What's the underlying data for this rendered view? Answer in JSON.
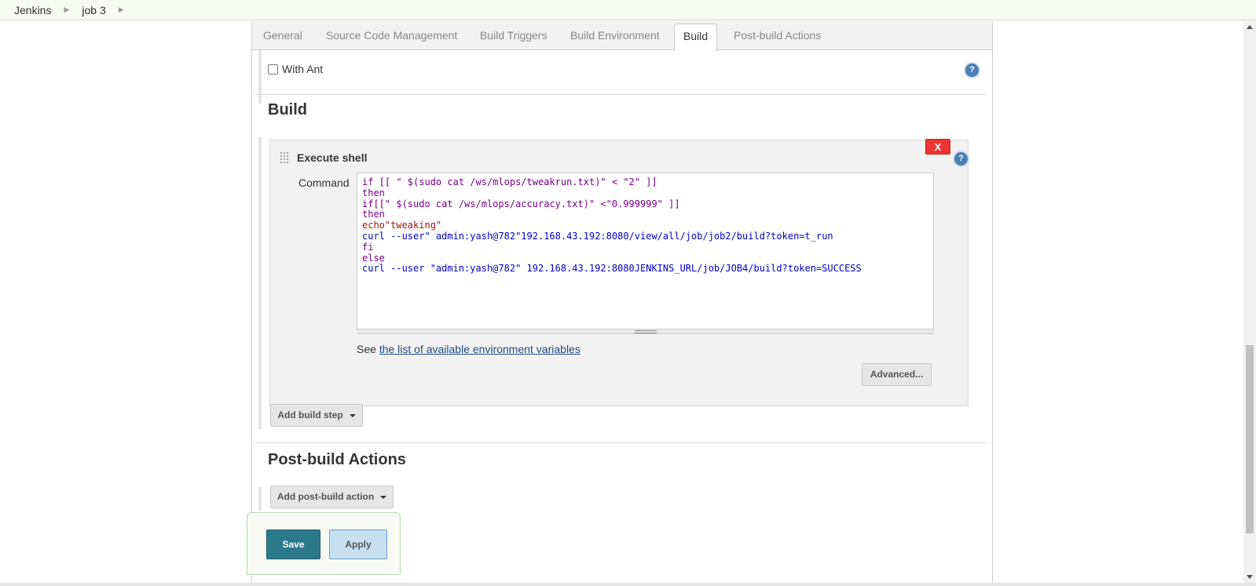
{
  "breadcrumb": {
    "items": [
      "Jenkins",
      "job 3"
    ]
  },
  "tabs": [
    {
      "label": "General"
    },
    {
      "label": "Source Code Management"
    },
    {
      "label": "Build Triggers"
    },
    {
      "label": "Build Environment"
    },
    {
      "label": "Build",
      "active": true
    },
    {
      "label": "Post-build Actions"
    }
  ],
  "build_env": {
    "with_ant_label": "With Ant",
    "with_ant_checked": false
  },
  "build": {
    "title": "Build",
    "step": {
      "title": "Execute shell",
      "delete_label": "X",
      "command_label": "Command",
      "command_lines": [
        "if [[ \" $(sudo cat /ws/mlops/tweakrun.txt)\" < \"2\" ]]",
        "then",
        "if[[\" $(sudo cat /ws/mlops/accuracy.txt)\" <\"0.999999\" ]]",
        "then",
        "echo\"tweaking\"",
        "curl --user\" admin:yash@782\"192.168.43.192:8080/view/all/job/job2/build?token=t_run",
        "fi",
        "else",
        "curl --user \"admin:yash@782\" 192.168.43.192:8080JENKINS_URL/job/JOB4/build?token=SUCCESS"
      ],
      "env_prefix": "See",
      "env_link": "the list of available environment variables",
      "advanced_label": "Advanced..."
    },
    "add_step_label": "Add build step"
  },
  "post_build": {
    "title": "Post-build Actions",
    "add_action_label": "Add post-build action"
  },
  "footer": {
    "save_label": "Save",
    "apply_label": "Apply"
  },
  "colors": {
    "header_bg": "#f6faf2",
    "save_bg": "#2a7a8c",
    "apply_bg": "#c8dff0",
    "delete_bg": "#ee3333",
    "help": "#4a7fb3"
  },
  "icons": {
    "help": "question-icon",
    "delete": "close-icon",
    "drag": "drag-handle-icon",
    "breadcrumb_sep": "chevron-right-icon",
    "dropdown": "caret-down-icon"
  }
}
